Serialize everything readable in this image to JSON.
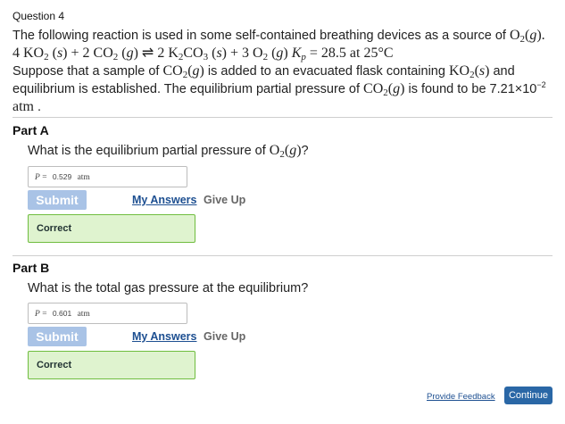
{
  "question": {
    "label": "Question 4"
  },
  "intro": {
    "line1_text": "The following reaction is used in some self-contained breathing devices as a source of ",
    "line1_species": "O2(g).",
    "equation": "4 KO2 (s) + 2 CO2 (g) ⇌ 2 K2CO3 (s) + 3 O2 (g)   Kp = 28.5 at 25°C",
    "line3_text_a": "Suppose that a sample of ",
    "line3_species_a": "CO2(g)",
    "line3_text_b": " is added to an evacuated flask containing ",
    "line3_species_b": "KO2(s)",
    "line3_text_c": " and",
    "line4_text_a": "equilibrium is established. The equilibrium partial pressure of ",
    "line4_species": "CO2(g)",
    "line4_text_b": " is found to be 7.21×10",
    "line4_exponent": "−2",
    "line5_unit": "atm",
    "line5_end": " ."
  },
  "partA": {
    "title": "Part A",
    "prompt_text": "What is the equilibrium partial pressure of ",
    "prompt_species": "O2(g)",
    "prompt_end": "?",
    "answer": {
      "var": "P",
      "eq": "=",
      "value": "0.529",
      "unit": "atm"
    },
    "submit_label": "Submit",
    "my_answers_label": "My Answers",
    "give_up_label": "Give Up",
    "status": "Correct"
  },
  "partB": {
    "title": "Part B",
    "prompt": "What is the total gas pressure at the equilibrium?",
    "answer": {
      "var": "P",
      "eq": "=",
      "value": "0.601",
      "unit": "atm"
    },
    "submit_label": "Submit",
    "my_answers_label": "My Answers",
    "give_up_label": "Give Up",
    "status": "Correct"
  },
  "footer": {
    "feedback_label": "Provide Feedback",
    "continue_label": "Continue"
  },
  "colors": {
    "link": "#1d4f91",
    "submit_disabled": "#a9c3e6",
    "correct_bg": "#dff3cf",
    "correct_border": "#6fbd3f",
    "continue_bg": "#2a67a6"
  }
}
